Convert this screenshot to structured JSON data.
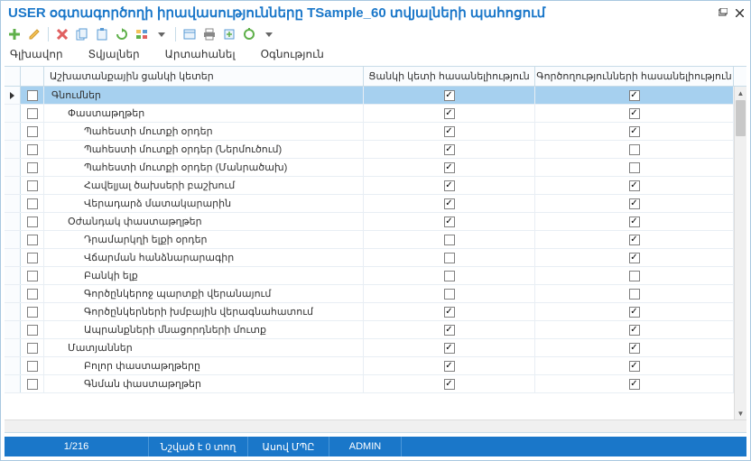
{
  "window": {
    "title": "USER օգտագործողի իրավասությունները TSample_60 տվյալների պահոցում"
  },
  "menu": {
    "items": [
      "Գլխավոր",
      "Տվյալներ",
      "Արտահանել",
      "Օգնություն"
    ]
  },
  "toolbar": {
    "icons": [
      "add",
      "edit",
      "delete",
      "copy",
      "paste",
      "refresh",
      "group",
      "sep",
      "view",
      "print",
      "export",
      "tool",
      "dropdown"
    ]
  },
  "grid": {
    "headers": {
      "name": "Աշխատանքային ցանկի կետեր",
      "c1": "Ցանկի կետի հասանելիություն",
      "c2": "Գործողությունների հասանելիություն"
    },
    "rows": [
      {
        "indent": 0,
        "label": "Գնումներ",
        "sel": false,
        "c1": true,
        "c2": true,
        "selected": true
      },
      {
        "indent": 1,
        "label": "Փաստաթղթեր",
        "sel": false,
        "c1": true,
        "c2": true
      },
      {
        "indent": 2,
        "label": "Պահեստի մուտքի օրդեր",
        "sel": false,
        "c1": true,
        "c2": true
      },
      {
        "indent": 2,
        "label": "Պահեստի մուտքի օրդեր (Ներմուծում)",
        "sel": false,
        "c1": true,
        "c2": false
      },
      {
        "indent": 2,
        "label": "Պահեստի մուտքի օրդեր (Մանրածախ)",
        "sel": false,
        "c1": true,
        "c2": false
      },
      {
        "indent": 2,
        "label": "Հավելյալ ծախսերի բաշխում",
        "sel": false,
        "c1": true,
        "c2": true
      },
      {
        "indent": 2,
        "label": "Վերադարձ մատակարարին",
        "sel": false,
        "c1": true,
        "c2": true
      },
      {
        "indent": 1,
        "label": "Օժանդակ փաստաթղթեր",
        "sel": false,
        "c1": true,
        "c2": true
      },
      {
        "indent": 2,
        "label": "Դրամարկղի ելքի օրդեր",
        "sel": false,
        "c1": false,
        "c2": true
      },
      {
        "indent": 2,
        "label": "Վճարման հանձնարարագիր",
        "sel": false,
        "c1": false,
        "c2": true
      },
      {
        "indent": 2,
        "label": "Բանկի ելք",
        "sel": false,
        "c1": false,
        "c2": false
      },
      {
        "indent": 2,
        "label": "Գործընկերոջ պարտքի վերանայում",
        "sel": false,
        "c1": false,
        "c2": false
      },
      {
        "indent": 2,
        "label": "Գործընկերների խմբային վերագնահատում",
        "sel": false,
        "c1": true,
        "c2": true
      },
      {
        "indent": 2,
        "label": "Ապրանքների մնացորդների մուտք",
        "sel": false,
        "c1": true,
        "c2": true
      },
      {
        "indent": 1,
        "label": "Մատյաններ",
        "sel": false,
        "c1": true,
        "c2": true
      },
      {
        "indent": 2,
        "label": "Բոլոր փաստաթղթերը",
        "sel": false,
        "c1": true,
        "c2": true
      },
      {
        "indent": 2,
        "label": "Գնման փաստաթղթեր",
        "sel": false,
        "c1": true,
        "c2": true
      }
    ]
  },
  "status": {
    "position": "1/216",
    "marked": "Նշված է 0 տող",
    "mode": "Ասով ՄՊԸ",
    "user": "ADMIN"
  }
}
